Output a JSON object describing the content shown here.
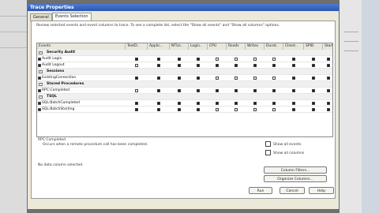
{
  "window": {
    "title": "Trace Properties"
  },
  "tabs": [
    {
      "label": "General"
    },
    {
      "label": "Events Selection"
    }
  ],
  "instructions": "Review selected events and event columns to trace. To see a complete list, select the \"Show all events\" and \"Show all columns\" options.",
  "grid": {
    "columns": [
      "Events",
      "TextD..",
      "Applic..",
      "NTUs..",
      "Login..",
      "CPU",
      "Reads",
      "Writes",
      "Durat..",
      "Client..",
      "SPID",
      "StartT.."
    ],
    "rows": [
      {
        "kind": "category",
        "name": "Security Audit",
        "checks": []
      },
      {
        "kind": "event",
        "name": "Audit Login",
        "checks": [
          true,
          true,
          true,
          true,
          false,
          false,
          false,
          false,
          true,
          true,
          true
        ]
      },
      {
        "kind": "event",
        "name": "Audit Logout",
        "checks": [
          false,
          true,
          true,
          true,
          true,
          true,
          true,
          true,
          true,
          true,
          true
        ]
      },
      {
        "kind": "category",
        "name": "Sessions",
        "checks": []
      },
      {
        "kind": "event",
        "name": "ExistingConnection",
        "checks": [
          true,
          true,
          true,
          true,
          false,
          false,
          false,
          false,
          true,
          true,
          true
        ]
      },
      {
        "kind": "category",
        "name": "Stored Procedures",
        "checks": []
      },
      {
        "kind": "event",
        "name": "RPC:Completed",
        "checks": [
          false,
          true,
          true,
          true,
          true,
          true,
          true,
          true,
          true,
          true,
          true
        ]
      },
      {
        "kind": "category",
        "name": "TSQL",
        "checks": []
      },
      {
        "kind": "event",
        "name": "SQL:BatchCompleted",
        "checks": [
          true,
          true,
          true,
          true,
          true,
          true,
          true,
          true,
          true,
          true,
          true
        ]
      },
      {
        "kind": "event",
        "name": "SQL:BatchStarting",
        "checks": [
          true,
          true,
          true,
          true,
          false,
          false,
          false,
          false,
          true,
          true,
          true
        ]
      }
    ]
  },
  "description": {
    "title": "RPC:Completed",
    "text": "Occurs when a remote procedure call has been completed."
  },
  "column_info": "No data column selected.",
  "options": {
    "show_all_events": "Show all events",
    "show_all_columns": "Show all columns"
  },
  "buttons": {
    "column_filters": "Column Filters...",
    "organize_columns": "Organize Columns...",
    "run": "Run",
    "cancel": "Cancel",
    "help": "Help"
  }
}
